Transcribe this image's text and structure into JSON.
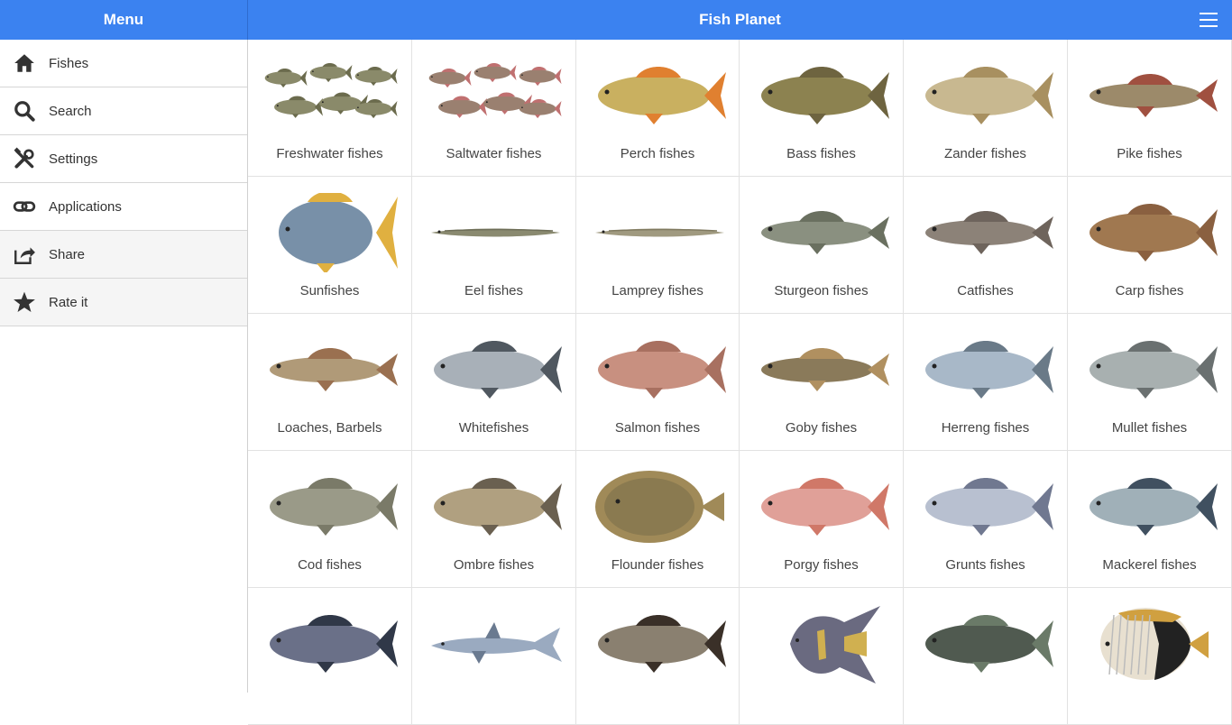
{
  "sidebar": {
    "title": "Menu",
    "items": [
      {
        "label": "Fishes",
        "icon": "home-icon"
      },
      {
        "label": "Search",
        "icon": "search-icon"
      },
      {
        "label": "Settings",
        "icon": "tools-icon"
      },
      {
        "label": "Applications",
        "icon": "link-icon"
      },
      {
        "label": "Share",
        "icon": "share-icon"
      },
      {
        "label": "Rate it",
        "icon": "star-icon"
      }
    ]
  },
  "header": {
    "title": "Fish Planet",
    "menu_icon": "hamburger-menu-icon"
  },
  "colors": {
    "header": "#3b82f0",
    "text": "#444444",
    "divider": "#e2e2e2"
  },
  "categories": [
    {
      "label": "Freshwater fishes",
      "kind": "group",
      "body": "#8a8a6a",
      "fin": "#6b6b4d"
    },
    {
      "label": "Saltwater fishes",
      "kind": "group",
      "body": "#9a8070",
      "fin": "#c07070"
    },
    {
      "label": "Perch fishes",
      "kind": "fish",
      "body": "#c9b060",
      "fin": "#e08030"
    },
    {
      "label": "Bass fishes",
      "kind": "fish",
      "body": "#8c8250",
      "fin": "#6e6440"
    },
    {
      "label": "Zander fishes",
      "kind": "fish",
      "body": "#c8b890",
      "fin": "#a89060"
    },
    {
      "label": "Pike fishes",
      "kind": "long",
      "body": "#9c8a6a",
      "fin": "#a05040"
    },
    {
      "label": "Sunfishes",
      "kind": "round",
      "body": "#7890a8",
      "fin": "#e0b040"
    },
    {
      "label": "Eel fishes",
      "kind": "eel",
      "body": "#8a8a70",
      "fin": "#6e6e58"
    },
    {
      "label": "Lamprey fishes",
      "kind": "eel",
      "body": "#a09a80",
      "fin": "#807a60"
    },
    {
      "label": "Sturgeon fishes",
      "kind": "long",
      "body": "#8a9080",
      "fin": "#6a7060"
    },
    {
      "label": "Catfishes",
      "kind": "long",
      "body": "#8c8278",
      "fin": "#6e645c"
    },
    {
      "label": "Carp fishes",
      "kind": "fish",
      "body": "#a07850",
      "fin": "#8a6040"
    },
    {
      "label": "Loaches, Barbels",
      "kind": "long",
      "body": "#b09a78",
      "fin": "#9a7050"
    },
    {
      "label": "Whitefishes",
      "kind": "fish",
      "body": "#a8b0b8",
      "fin": "#505860"
    },
    {
      "label": "Salmon fishes",
      "kind": "fish",
      "body": "#c89080",
      "fin": "#a87060"
    },
    {
      "label": "Goby fishes",
      "kind": "long",
      "body": "#8a7a5a",
      "fin": "#b09060"
    },
    {
      "label": "Herreng fishes",
      "kind": "fish",
      "body": "#a8b8c8",
      "fin": "#6a7a88"
    },
    {
      "label": "Mullet fishes",
      "kind": "fish",
      "body": "#a8b0b0",
      "fin": "#6a7070"
    },
    {
      "label": "Cod fishes",
      "kind": "fish",
      "body": "#9a9a88",
      "fin": "#7a7a68"
    },
    {
      "label": "Ombre fishes",
      "kind": "fish",
      "body": "#b0a080",
      "fin": "#6a6050"
    },
    {
      "label": "Flounder fishes",
      "kind": "flat",
      "body": "#8a7a50",
      "fin": "#a08a58"
    },
    {
      "label": "Porgy fishes",
      "kind": "fish",
      "body": "#e0a098",
      "fin": "#d07868"
    },
    {
      "label": "Grunts fishes",
      "kind": "fish",
      "body": "#b8c0d0",
      "fin": "#707890"
    },
    {
      "label": "Mackerel fishes",
      "kind": "fish",
      "body": "#a0b0b8",
      "fin": "#405060"
    },
    {
      "label": "",
      "kind": "fish",
      "body": "#6a7088",
      "fin": "#303848"
    },
    {
      "label": "",
      "kind": "shark",
      "body": "#9aaac0",
      "fin": "#6a7a90"
    },
    {
      "label": "",
      "kind": "fish",
      "body": "#8a8070",
      "fin": "#3a3028"
    },
    {
      "label": "",
      "kind": "angel",
      "body": "#6a6a80",
      "fin": "#d0b050"
    },
    {
      "label": "",
      "kind": "fish",
      "body": "#505a50",
      "fin": "#6a7a68"
    },
    {
      "label": "",
      "kind": "butterfly",
      "body": "#e8e0d0",
      "fin": "#d0a040"
    }
  ]
}
